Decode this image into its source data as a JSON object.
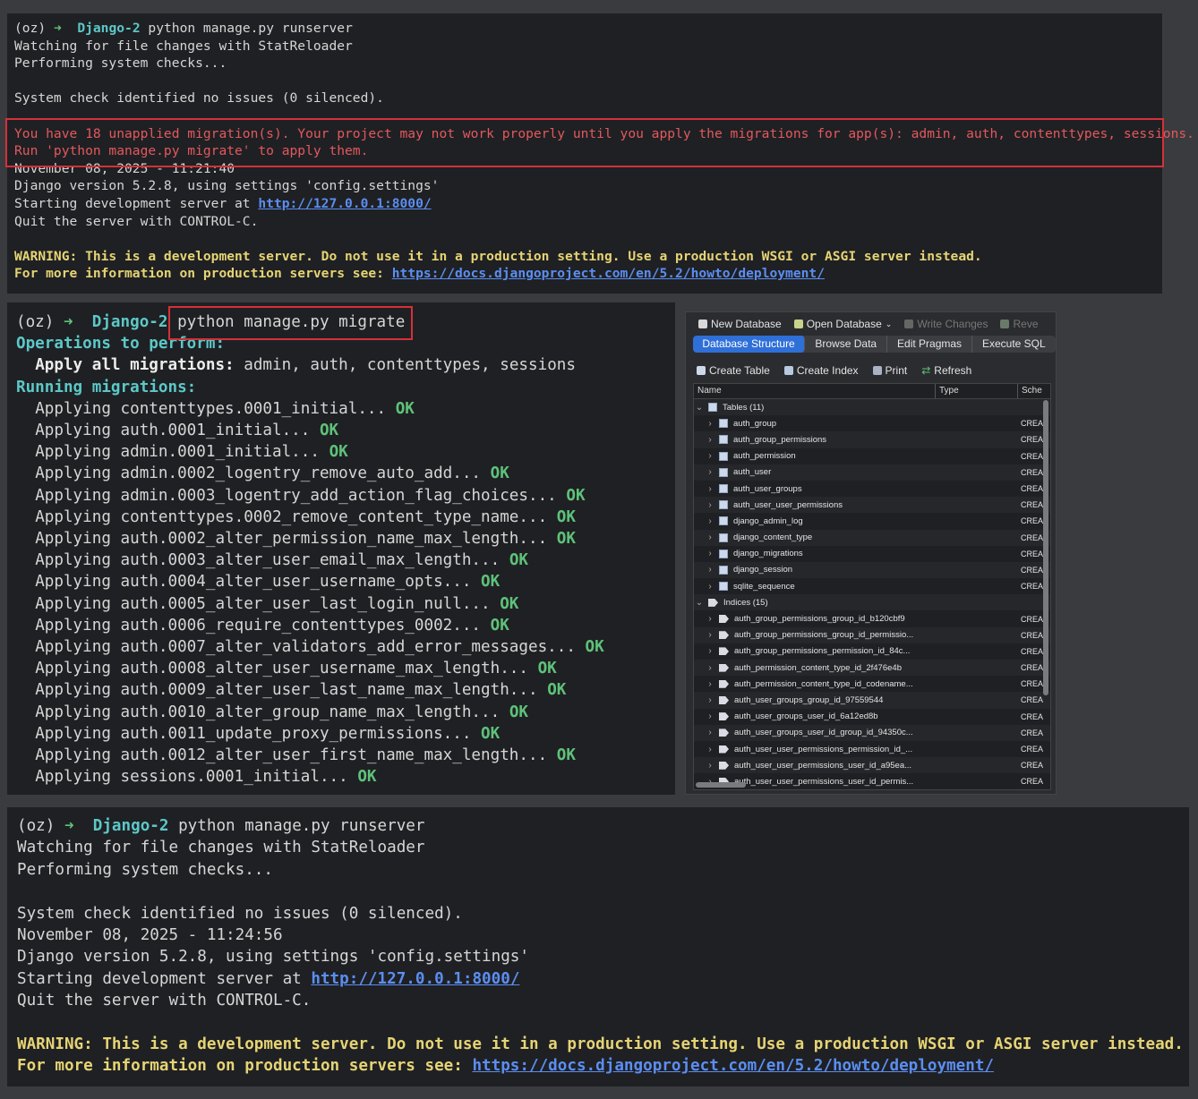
{
  "terminal1": {
    "prompt": {
      "env": "(oz)",
      "arrow": "➜",
      "dir": "Django-2",
      "command": "python manage.py runserver"
    },
    "lines_before": [
      "Watching for file changes with StatReloader",
      "Performing system checks...",
      "",
      "System check identified no issues (0 silenced).",
      ""
    ],
    "error_lines": [
      "You have 18 unapplied migration(s). Your project may not work properly until you apply the migrations for app(s): admin, auth, contenttypes, sessions.",
      "Run 'python manage.py migrate' to apply them."
    ],
    "timestamp": "November 08, 2025 - 11:21:40",
    "version_line": "Django version 5.2.8, using settings 'config.settings'",
    "server_prefix": "Starting development server at ",
    "server_url": "http://127.0.0.1:8000/",
    "quit_line": "Quit the server with CONTROL-C.",
    "warning": "WARNING: This is a development server. Do not use it in a production setting. Use a production WSGI or ASGI server instead.",
    "info_prefix": "For more information on production servers see: ",
    "info_url": "https://docs.djangoproject.com/en/5.2/howto/deployment/"
  },
  "terminal2": {
    "prompt": {
      "env": "(oz)",
      "arrow": "➜",
      "dir": "Django-2",
      "command": "python manage.py migrate"
    },
    "ops_heading": "Operations to perform:",
    "apply_label": "Apply all migrations:",
    "apply_apps": " admin, auth, contenttypes, sessions",
    "running_heading": "Running migrations:",
    "ok": "OK",
    "migrations": [
      "Applying contenttypes.0001_initial...",
      "Applying auth.0001_initial...",
      "Applying admin.0001_initial...",
      "Applying admin.0002_logentry_remove_auto_add...",
      "Applying admin.0003_logentry_add_action_flag_choices...",
      "Applying contenttypes.0002_remove_content_type_name...",
      "Applying auth.0002_alter_permission_name_max_length...",
      "Applying auth.0003_alter_user_email_max_length...",
      "Applying auth.0004_alter_user_username_opts...",
      "Applying auth.0005_alter_user_last_login_null...",
      "Applying auth.0006_require_contenttypes_0002...",
      "Applying auth.0007_alter_validators_add_error_messages...",
      "Applying auth.0008_alter_user_username_max_length...",
      "Applying auth.0009_alter_user_last_name_max_length...",
      "Applying auth.0010_alter_group_name_max_length...",
      "Applying auth.0011_update_proxy_permissions...",
      "Applying auth.0012_alter_user_first_name_max_length...",
      "Applying sessions.0001_initial..."
    ]
  },
  "db_browser": {
    "toolbar": [
      "New Database",
      "Open Database",
      "Write Changes",
      "Reve"
    ],
    "tabs": [
      "Database Structure",
      "Browse Data",
      "Edit Pragmas",
      "Execute SQL"
    ],
    "actions": [
      "Create Table",
      "Create Index",
      "Print",
      "Refresh"
    ],
    "columns": [
      "Name",
      "Type",
      "Sche"
    ],
    "tables_group": "Tables (11)",
    "tables": [
      "auth_group",
      "auth_group_permissions",
      "auth_permission",
      "auth_user",
      "auth_user_groups",
      "auth_user_user_permissions",
      "django_admin_log",
      "django_content_type",
      "django_migrations",
      "django_session",
      "sqlite_sequence"
    ],
    "indices_group": "Indices (15)",
    "indices": [
      "auth_group_permissions_group_id_b120cbf9",
      "auth_group_permissions_group_id_permissio...",
      "auth_group_permissions_permission_id_84c...",
      "auth_permission_content_type_id_2f476e4b",
      "auth_permission_content_type_id_codename...",
      "auth_user_groups_group_id_97559544",
      "auth_user_groups_user_id_6a12ed8b",
      "auth_user_groups_user_id_group_id_94350c...",
      "auth_user_user_permissions_permission_id_...",
      "auth_user_user_permissions_user_id_a95ea...",
      "auth_user_user_permissions_user_id_permis..."
    ],
    "schema_prefix": "CREA"
  },
  "terminal3": {
    "prompt": {
      "env": "(oz)",
      "arrow": "➜",
      "dir": "Django-2",
      "command": "python manage.py runserver"
    },
    "lines_before": [
      "Watching for file changes with StatReloader",
      "Performing system checks...",
      "",
      "System check identified no issues (0 silenced)."
    ],
    "timestamp": "November 08, 2025 - 11:24:56",
    "version_line": "Django version 5.2.8, using settings 'config.settings'",
    "server_prefix": "Starting development server at ",
    "server_url": "http://127.0.0.1:8000/",
    "quit_line": "Quit the server with CONTROL-C.",
    "warning": "WARNING: This is a development server. Do not use it in a production setting. Use a production WSGI or ASGI server instead.",
    "info_prefix": "For more information on production servers see: ",
    "info_url": "https://docs.djangoproject.com/en/5.2/howto/deployment/"
  },
  "colors": {
    "ok": "#5ec27a",
    "dir": "#5cc8c8",
    "error": "#e2595f",
    "warning": "#e6d474",
    "link": "#5b8ef2",
    "highlight_box": "#d5303a"
  }
}
